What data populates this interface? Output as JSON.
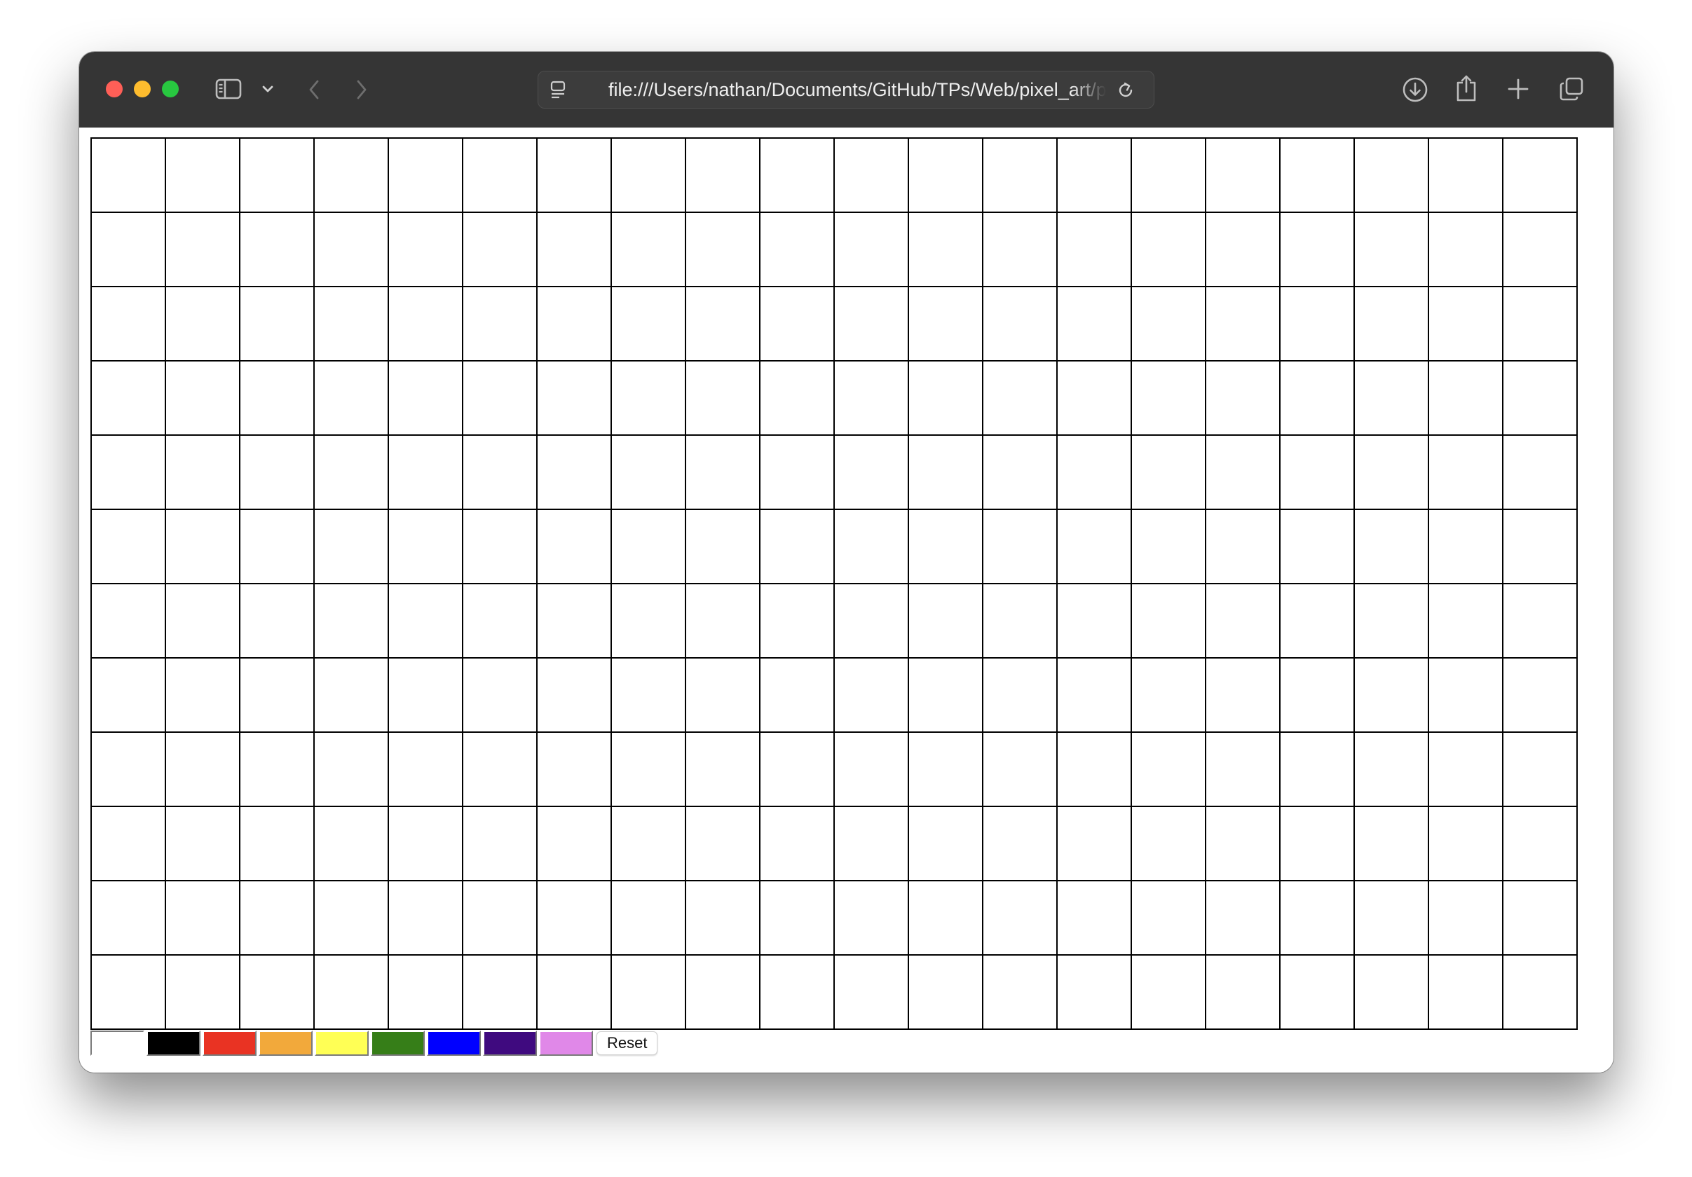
{
  "browser": {
    "url": "file:///Users/nathan/Documents/GitHub/TPs/Web/pixel_art/p",
    "traffic_lights": {
      "close": "#ff5f57",
      "minimize": "#febc2e",
      "maximize": "#28c840"
    },
    "toolbar_icons": [
      "sidebar-icon",
      "chevron-down-icon",
      "back-icon",
      "forward-icon",
      "page-menu-icon",
      "reload-icon",
      "download-icon",
      "share-icon",
      "new-tab-icon",
      "tab-overview-icon"
    ]
  },
  "canvas": {
    "columns": 20,
    "rows": 12,
    "cell_color": "#ffffff",
    "line_color": "#000000"
  },
  "palette": {
    "colors": [
      "#ffffff",
      "#000000",
      "#e93323",
      "#f2a93b",
      "#ffff55",
      "#367e18",
      "#0000ff",
      "#3f0a7f",
      "#e088e8"
    ],
    "selected_index": 0,
    "reset_label": "Reset"
  }
}
